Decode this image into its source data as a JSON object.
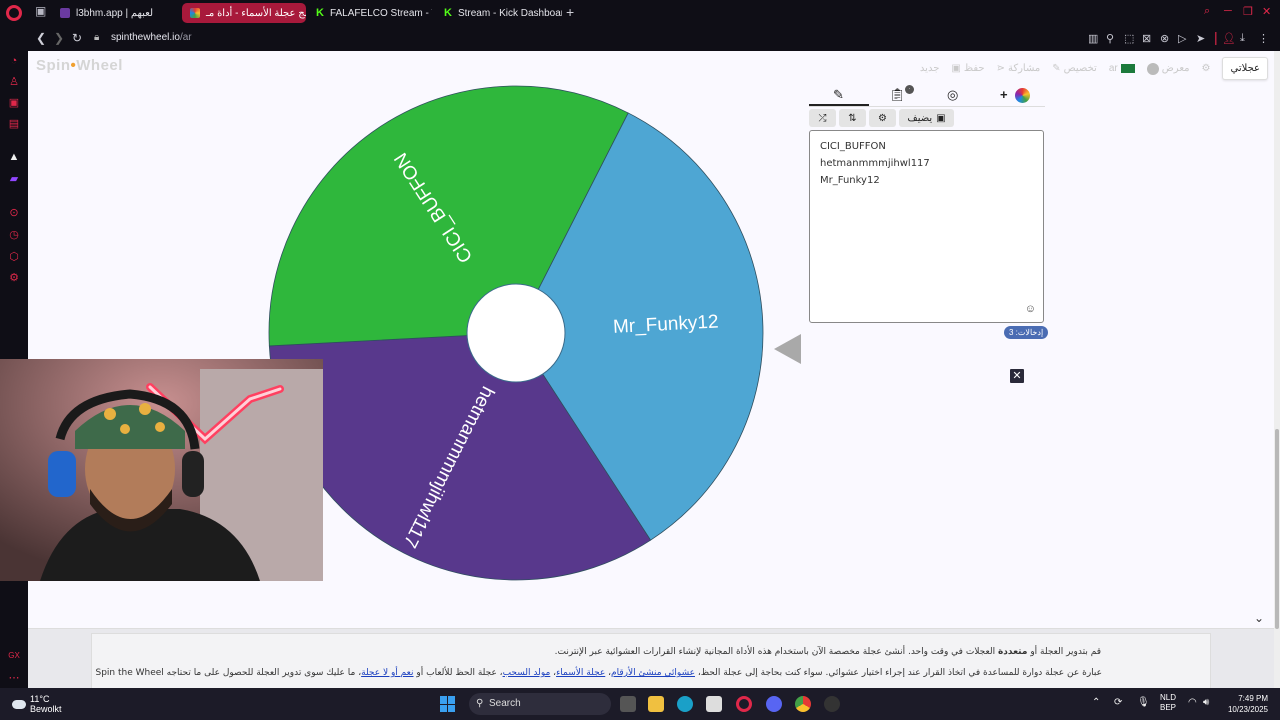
{
  "browser": {
    "tabs": [
      {
        "label": "l3bhm.app | لعبهم",
        "active": false
      },
      {
        "label": "برنامج عجلة الأسماء - أداة مـ",
        "active": true
      },
      {
        "label": "FALAFELCO Stream - Wa",
        "active": false
      },
      {
        "label": "Stream - Kick Dashboard",
        "active": false
      }
    ],
    "new_tab": "+",
    "url_host": "spinthewheel.io",
    "url_path": "/ar"
  },
  "site": {
    "logo_part1": "Spin",
    "logo_part2": "Wheel",
    "nav": {
      "my_wheels": "عجلاتي",
      "gallery": "معرض",
      "language": "ar",
      "customize": "تخصيص",
      "share": "مشاركة",
      "save": "حفظ",
      "new": "جديد"
    }
  },
  "wheel": {
    "segments": [
      {
        "label": "Mr_Funky12",
        "color": "#4ea6d3"
      },
      {
        "label": "hetmanmmmjihwl117",
        "color": "#58388c"
      },
      {
        "label": "CICI_BUFFON",
        "color": "#2fb73c"
      }
    ]
  },
  "editor": {
    "add_label": "يضيف",
    "entries": [
      "CICI_BUFFON",
      "hetmanmmmjihwl117",
      "Mr_Funky12"
    ],
    "entries_count_label": "إدخالات: 3"
  },
  "footer": {
    "line1_a": "قم بتدوير العجلة أو",
    "line1_bold": "متعددة",
    "line1_b": "العجلات في وقت واحد. أنشئ عجلة مخصصة الآن باستخدام هذه الأداة المجانية لإنشاء القرارات العشوائية عبر الإنترنت.",
    "line2_a": "عبارة عن عجلة دوارة للمساعدة في اتخاذ القرار عند إجراء اختيار عشوائي. سواء كنت بحاجة إلى عجلة الحظ،",
    "link1": "عشوائي منشئ الأرقام",
    "link2": "عجلة الأسماء",
    "link3": "مولد السحب",
    "line2_b": "عجلة الحظ للألعاب أو",
    "link4": "نعم أو لا عجلة",
    "line2_c": "ما عليك سوى تدوير العجلة للحصول على ما تحتاجه",
    "brand": "Spin the Wheel"
  },
  "taskbar": {
    "temp": "11°C",
    "weather": "Bewolkt",
    "search": "Search",
    "lang1": "NLD",
    "lang2": "BEP",
    "time": "7:49 PM",
    "date": "10/23/2025"
  }
}
